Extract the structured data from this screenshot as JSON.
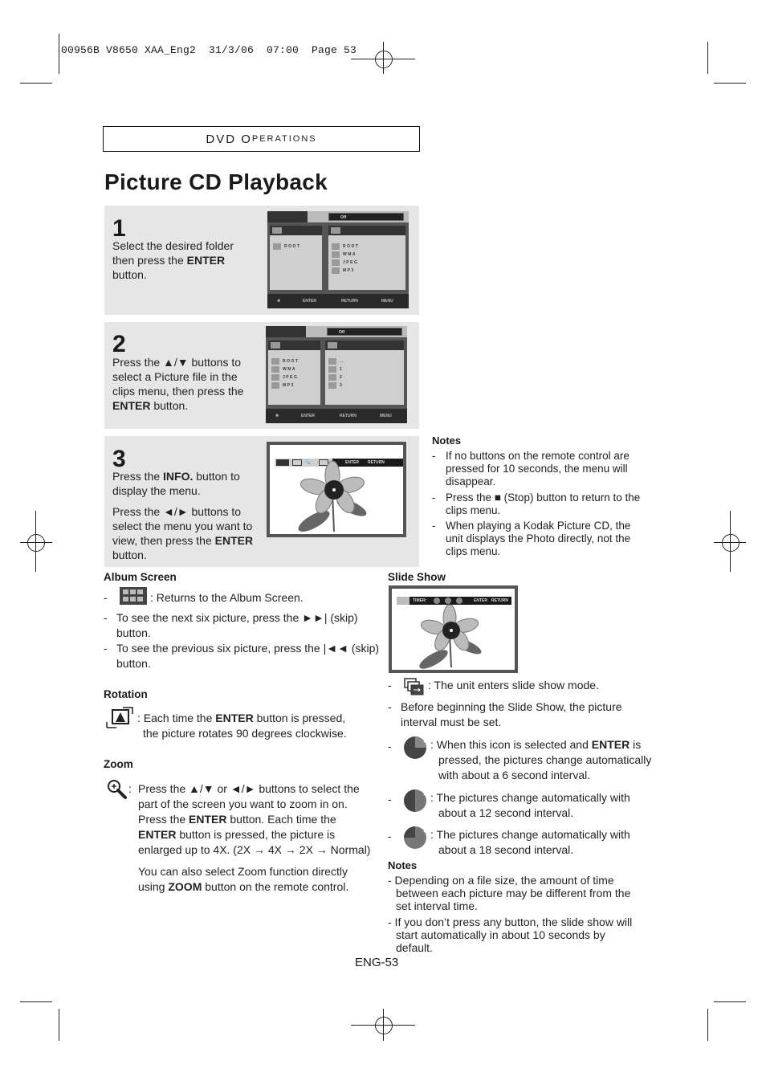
{
  "print_header": "00956B V8650 XAA_Eng2  31/3/06  07:00  Page 53",
  "section": {
    "first_letter": "DVD O",
    "rest": "PERATIONS"
  },
  "title": "Picture CD Playback",
  "steps": [
    {
      "number": "1",
      "lines": [
        {
          "pre": "Select the desired folder",
          "bold": "",
          "post": ""
        },
        {
          "pre": "then press the ",
          "bold": "ENTER",
          "post": ""
        },
        {
          "pre": "button.",
          "bold": "",
          "post": ""
        }
      ],
      "screen": {
        "off_label": "Off",
        "left_items": [
          "ROOT"
        ],
        "right_items": [
          "ROOT",
          "WMA",
          "JPEG",
          "MP3"
        ],
        "bottom": [
          "ENTER",
          "RETURN",
          "MENU"
        ]
      }
    },
    {
      "number": "2",
      "lines": [
        {
          "pre": "Press the ▲/▼ buttons to",
          "bold": "",
          "post": ""
        },
        {
          "pre": "select a Picture file in the",
          "bold": "",
          "post": ""
        },
        {
          "pre": "clips menu, then press the",
          "bold": "",
          "post": ""
        },
        {
          "pre": "",
          "bold": "ENTER",
          "post": " button."
        }
      ],
      "screen": {
        "off_label": "Off",
        "left_items": [
          "ROOT",
          "WMA",
          "JPEG",
          "MP3"
        ],
        "right_items": [
          "..",
          "1",
          "2",
          "3"
        ],
        "bottom": [
          "ENTER",
          "RETURN",
          "MENU"
        ]
      }
    },
    {
      "number": "3",
      "lines_a": [
        {
          "pre": "Press the ",
          "bold": "INFO.",
          "post": " button to"
        },
        {
          "pre": "display the menu.",
          "bold": "",
          "post": ""
        }
      ],
      "lines_b": [
        {
          "pre": "Press the ◄/► buttons to",
          "bold": "",
          "post": ""
        },
        {
          "pre": "select the menu you want to",
          "bold": "",
          "post": ""
        },
        {
          "pre": "view, then press the ",
          "bold": "ENTER",
          "post": ""
        },
        {
          "pre": "button.",
          "bold": "",
          "post": ""
        }
      ],
      "screen": {
        "toolbar_labels": [
          "ENTER",
          "RETURN"
        ]
      }
    }
  ],
  "notes_top": {
    "title": "Notes",
    "items": [
      [
        "If no buttons on the remote control are",
        "pressed for 10 seconds, the menu will",
        "disappear."
      ],
      [
        "Press the ■ (Stop) button to return to the",
        "clips menu."
      ],
      [
        "When playing a Kodak Picture CD, the",
        "unit displays the Photo directly, not the",
        "clips menu."
      ]
    ]
  },
  "album_screen": {
    "title": "Album Screen",
    "items": [
      [
        ": Returns to the Album Screen."
      ],
      [
        "To see the next six picture, press the ►►| (skip)",
        "button."
      ],
      [
        "To see the previous six picture, press the |◄◄ (skip)",
        "button."
      ]
    ]
  },
  "rotation": {
    "title": "Rotation",
    "line1_pre": ": Each time the ",
    "line1_bold": "ENTER",
    "line1_post": " button is pressed,",
    "line2": "the picture rotates 90 degrees clockwise."
  },
  "zoom": {
    "title": "Zoom",
    "lines": [
      {
        "pre": "Press the ▲/▼ or ◄/► buttons to select the",
        "bold": "",
        "post": ""
      },
      {
        "pre": "part of the screen you want to zoom in on.",
        "bold": "",
        "post": ""
      },
      {
        "pre": "Press the ",
        "bold": "ENTER",
        "post": " button. Each time the"
      },
      {
        "pre": "",
        "bold": "ENTER",
        "post": " button is pressed, the picture is"
      },
      {
        "pre": "enlarged up to 4X. (2X → 4X → 2X → Normal)",
        "bold": "",
        "post": ""
      }
    ],
    "extra": [
      {
        "pre": "You can also select Zoom function directly",
        "bold": "",
        "post": ""
      },
      {
        "pre": "using ",
        "bold": "ZOOM",
        "post": " button on the remote control."
      }
    ]
  },
  "slide_show": {
    "title": "Slide Show",
    "screen": {
      "timer_label": "TIMER:",
      "toolbar_labels": [
        "ENTER",
        "RETURN"
      ]
    },
    "items": [
      {
        "lines": [
          ": The unit enters slide show mode."
        ]
      },
      {
        "lines": [
          "Before beginning the Slide Show, the picture",
          "interval must be set."
        ]
      },
      {
        "line1_pre": ": When this icon is selected and ",
        "line1_bold": "ENTER",
        "line1_post": " is",
        "lines": [
          "pressed, the pictures change automatically",
          "with about a 6 second interval."
        ]
      },
      {
        "lines": [
          ": The pictures change automatically with",
          "about a 12 second interval."
        ]
      },
      {
        "lines": [
          ": The pictures change automatically with",
          "about a 18 second interval."
        ]
      }
    ]
  },
  "notes_bottom": {
    "title": "Notes",
    "items": [
      [
        "- Depending on a file size, the amount of time",
        "between each picture may be different from the",
        "set interval time."
      ],
      [
        "- If you don’t press any button, the slide show will",
        "start automatically in about 10 seconds by",
        "default."
      ]
    ]
  },
  "page_number": "ENG-53"
}
